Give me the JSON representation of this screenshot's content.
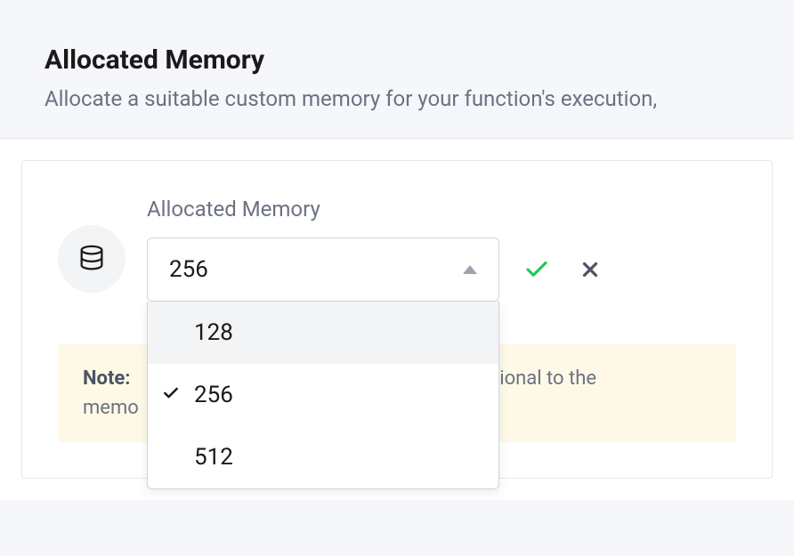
{
  "header": {
    "title": "Allocated Memory",
    "subtitle": "Allocate a suitable custom memory for your function's execution,"
  },
  "field": {
    "label": "Allocated Memory",
    "selected": "256",
    "options": [
      "128",
      "256",
      "512"
    ]
  },
  "note": {
    "label": "Note:",
    "text_visible_right": "ional to the",
    "text_visible_left": "memo"
  },
  "icons": {
    "confirm": "check-icon",
    "cancel": "close-icon",
    "database": "database-icon"
  }
}
